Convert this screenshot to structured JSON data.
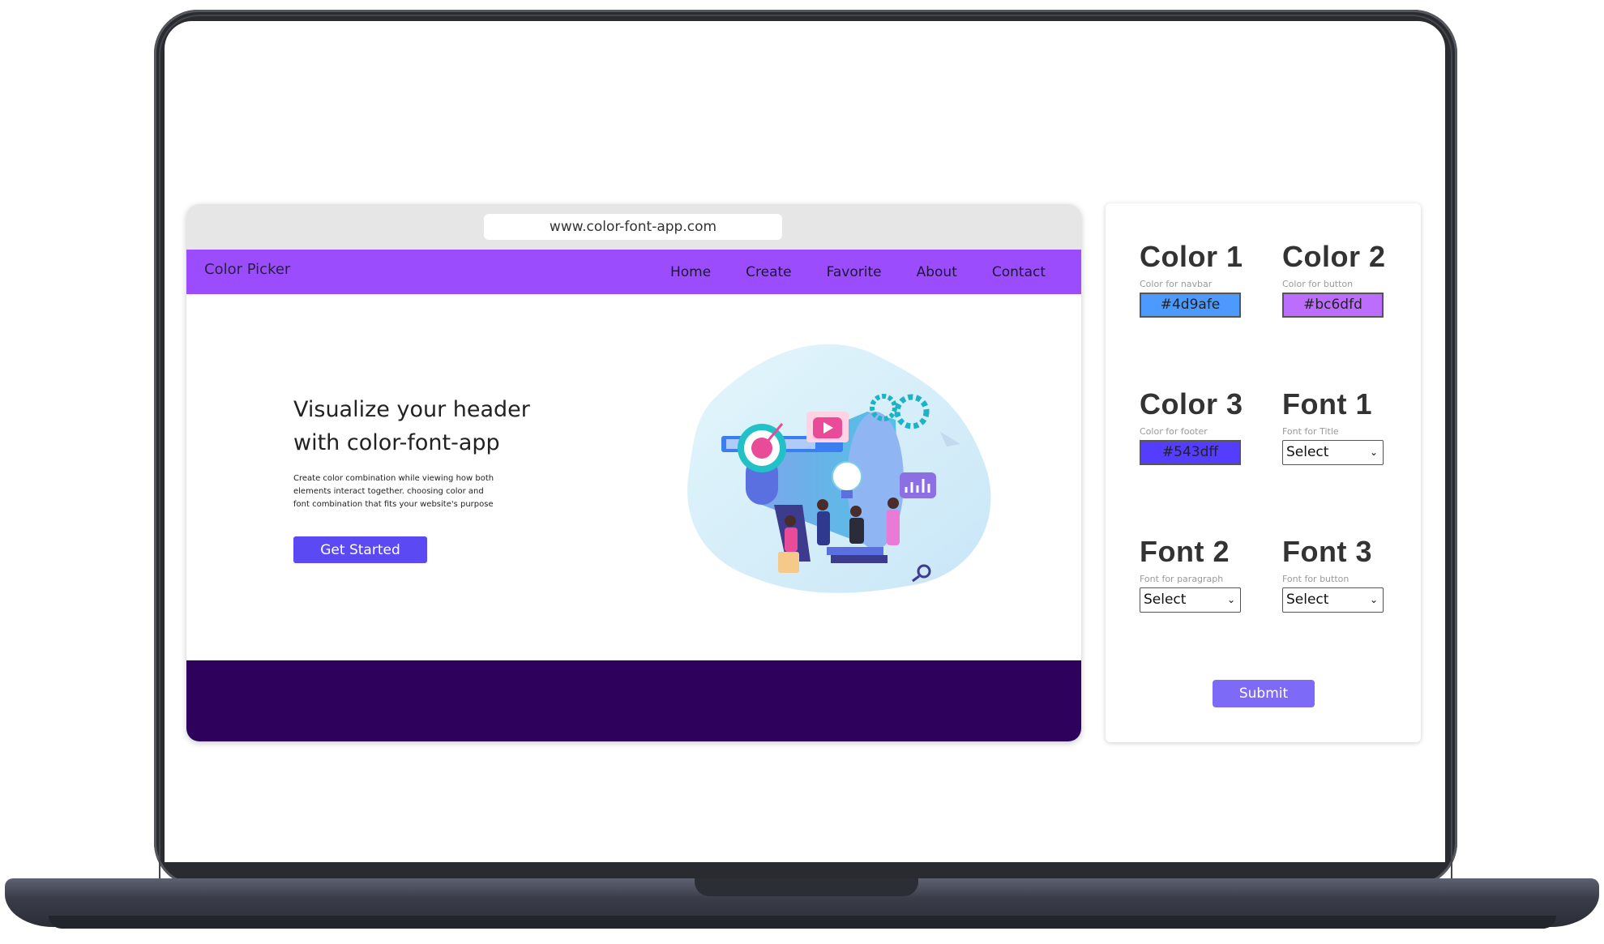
{
  "browser": {
    "url": "www.color-font-app.com"
  },
  "site": {
    "brand": "Color Picker",
    "nav": [
      "Home",
      "Create",
      "Favorite",
      "About",
      "Contact"
    ],
    "hero": {
      "title": "Visualize your header with color-font-app",
      "text": "Create color combination while viewing how both elements interact together. choosing color and font combination that fits your website's purpose",
      "button": "Get Started"
    },
    "colors": {
      "navbar": "#9b4dfd",
      "button": "#5b4af3",
      "footer": "#2d015c"
    }
  },
  "panel": {
    "color1": {
      "title": "Color 1",
      "hint": "Color for navbar",
      "value": "#4d9afe"
    },
    "color2": {
      "title": "Color 2",
      "hint": "Color for button",
      "value": "#bc6dfd"
    },
    "color3": {
      "title": "Color 3",
      "hint": "Color for footer",
      "value": "#543dff"
    },
    "font1": {
      "title": "Font 1",
      "hint": "Font for Title",
      "value": "Select"
    },
    "font2": {
      "title": "Font 2",
      "hint": "Font for paragraph",
      "value": "Select"
    },
    "font3": {
      "title": "Font 3",
      "hint": "Font for button",
      "value": "Select"
    },
    "submit": "Submit"
  }
}
